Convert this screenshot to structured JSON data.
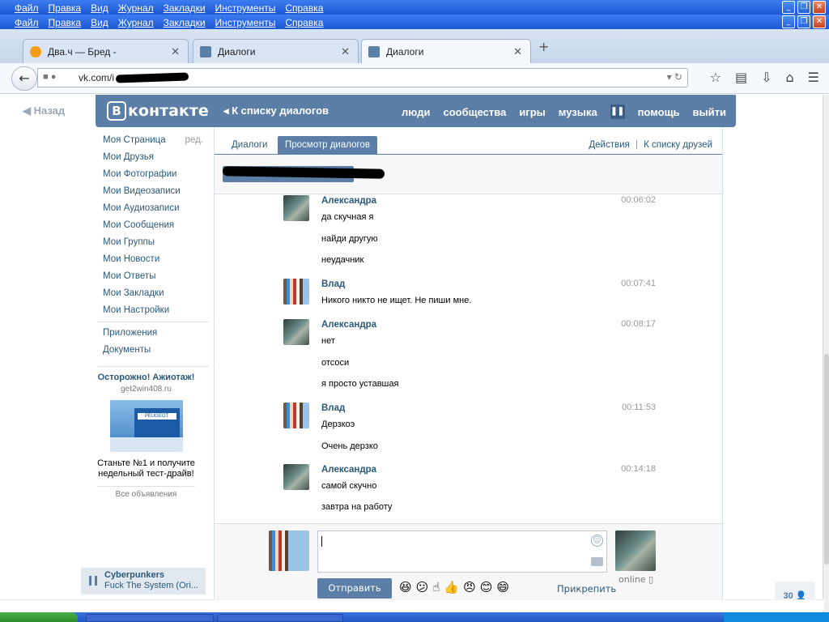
{
  "menubar": {
    "items": [
      "Файл",
      "Правка",
      "Вид",
      "Журнал",
      "Закладки",
      "Инструменты",
      "Справка"
    ]
  },
  "window_controls": [
    "_",
    "❐",
    "✕"
  ],
  "browser_tabs": [
    {
      "label": "Два.ч — Бред -",
      "close": "✕"
    },
    {
      "label": "Диалоги",
      "close": "✕"
    },
    {
      "label": "Диалоги",
      "close": "✕"
    }
  ],
  "new_tab": "+",
  "address": {
    "url": "vk.com/i"
  },
  "vk": {
    "back_left": "Назад",
    "logo": "контакте",
    "logo_b": "В",
    "back_to_list": "К списку диалогов",
    "nav": [
      "люди",
      "сообщества",
      "игры",
      "музыка",
      "помощь",
      "выйти"
    ]
  },
  "sidebar": {
    "items": [
      "Моя Страница",
      "Мои Друзья",
      "Мои Фотографии",
      "Мои Видеозаписи",
      "Мои Аудиозаписи",
      "Мои Сообщения",
      "Мои Группы",
      "Мои Новости",
      "Мои Ответы",
      "Мои Закладки",
      "Мои Настройки"
    ],
    "edit": "ред.",
    "extra": [
      "Приложения",
      "Документы"
    ]
  },
  "ad": {
    "title": "Осторожно! Ажиотаж!",
    "url": "get2win408.ru",
    "image_text": "PEUGEOT",
    "text": "Станьте №1 и получите недельный тест-драйв!",
    "all_ads": "Все объявления"
  },
  "player": {
    "artist": "Cyberpunkers",
    "track": "Fuck The System (Ori..."
  },
  "tabs": {
    "dialogs": "Диалоги",
    "view": "Просмотр диалогов",
    "actions": "Действия",
    "sep": "|",
    "friends": "К списку друзей"
  },
  "messages": [
    {
      "name": "Александра",
      "time": "00:06:02",
      "lines": [
        "да скучная я",
        "найди другую",
        "неудачник"
      ]
    },
    {
      "name": "Влад",
      "time": "00:07:41",
      "lines": [
        "Никого никто не ищет. Не пиши мне."
      ]
    },
    {
      "name": "Александра",
      "time": "00:08:17",
      "lines": [
        "нет",
        "отсоси",
        "я просто уставшая"
      ]
    },
    {
      "name": "Влад",
      "time": "00:11:53",
      "lines": [
        "Дерзкоэ",
        "Очень дерзко"
      ]
    },
    {
      "name": "Александра",
      "time": "00:14:18",
      "lines": [
        "самой скучно",
        "завтра на работу"
      ]
    }
  ],
  "compose": {
    "send": "Отправить",
    "attach": "Прикрепить",
    "online": "online",
    "emojis": [
      "😆",
      "😕",
      "☝",
      "👍",
      "😠",
      "😊",
      "😄"
    ]
  },
  "counter": "30"
}
